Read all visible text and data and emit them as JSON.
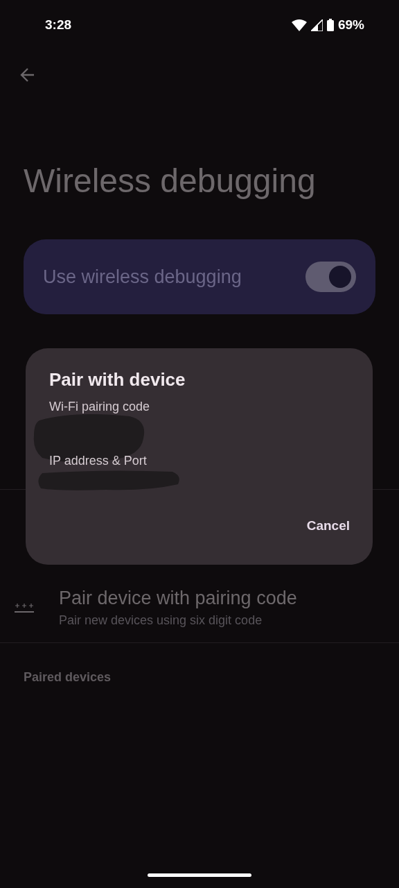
{
  "status_bar": {
    "time": "3:28",
    "battery": "69%"
  },
  "page": {
    "title": "Wireless debugging",
    "main_switch": {
      "label": "Use wireless debugging",
      "on": true
    },
    "items": [
      {
        "title": "Pair device with pairing code",
        "subtitle": "Pair new devices using six digit code"
      }
    ],
    "section_header": "Paired devices"
  },
  "dialog": {
    "title": "Pair with device",
    "fields": [
      {
        "label": "Wi-Fi pairing code",
        "redacted": true
      },
      {
        "label": "IP address & Port",
        "redacted": true
      }
    ],
    "buttons": [
      "Cancel"
    ]
  }
}
